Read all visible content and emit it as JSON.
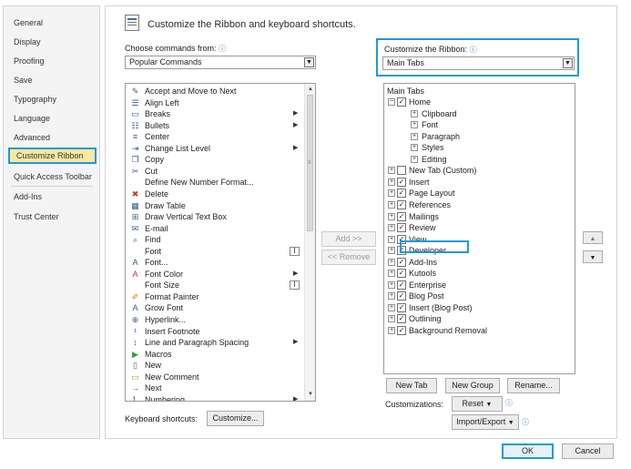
{
  "sidebar": {
    "items": [
      "General",
      "Display",
      "Proofing",
      "Save",
      "Typography",
      "Language",
      "Advanced",
      "Customize Ribbon",
      "Quick Access Toolbar",
      "Add-Ins",
      "Trust Center"
    ],
    "selected": "Customize Ribbon"
  },
  "header": {
    "title": "Customize the Ribbon and keyboard shortcuts."
  },
  "left": {
    "choose_label": "Choose commands from:",
    "choose_value": "Popular Commands",
    "commands": [
      {
        "label": "Accept and Move to Next",
        "icon": "accept-icon"
      },
      {
        "label": "Align Left",
        "icon": "align-left-icon"
      },
      {
        "label": "Breaks",
        "icon": "breaks-icon",
        "sub": true
      },
      {
        "label": "Bullets",
        "icon": "bullets-icon",
        "sub": true
      },
      {
        "label": "Center",
        "icon": "center-icon"
      },
      {
        "label": "Change List Level",
        "icon": "list-level-icon",
        "sub": true
      },
      {
        "label": "Copy",
        "icon": "copy-icon"
      },
      {
        "label": "Cut",
        "icon": "cut-icon"
      },
      {
        "label": "Define New Number Format...",
        "icon": ""
      },
      {
        "label": "Delete",
        "icon": "delete-icon"
      },
      {
        "label": "Draw Table",
        "icon": "draw-table-icon"
      },
      {
        "label": "Draw Vertical Text Box",
        "icon": "text-box-icon"
      },
      {
        "label": "E-mail",
        "icon": "email-icon"
      },
      {
        "label": "Find",
        "icon": "find-icon"
      },
      {
        "label": "Font",
        "icon": "",
        "ibeam": true
      },
      {
        "label": "Font...",
        "icon": "font-icon"
      },
      {
        "label": "Font Color",
        "icon": "font-color-icon",
        "sub": true
      },
      {
        "label": "Font Size",
        "icon": "",
        "ibeam": true
      },
      {
        "label": "Format Painter",
        "icon": "format-painter-icon"
      },
      {
        "label": "Grow Font",
        "icon": "grow-font-icon"
      },
      {
        "label": "Hyperlink...",
        "icon": "hyperlink-icon"
      },
      {
        "label": "Insert Footnote",
        "icon": "footnote-icon"
      },
      {
        "label": "Line and Paragraph Spacing",
        "icon": "line-spacing-icon",
        "sub": true
      },
      {
        "label": "Macros",
        "icon": "macros-icon"
      },
      {
        "label": "New",
        "icon": "new-icon"
      },
      {
        "label": "New Comment",
        "icon": "comment-icon"
      },
      {
        "label": "Next",
        "icon": "next-icon"
      },
      {
        "label": "Numbering",
        "icon": "numbering-icon",
        "sub": true
      }
    ],
    "keyboard_label": "Keyboard shortcuts:",
    "customize_btn": "Customize..."
  },
  "middle": {
    "add_btn": "Add >>",
    "remove_btn": "<< Remove"
  },
  "right": {
    "ribbon_label": "Customize the Ribbon:",
    "ribbon_value": "Main Tabs",
    "tree_header": "Main Tabs",
    "tree": [
      {
        "label": "Home",
        "level": 0,
        "expanded": true,
        "checked": true
      },
      {
        "label": "Clipboard",
        "level": 1
      },
      {
        "label": "Font",
        "level": 1
      },
      {
        "label": "Paragraph",
        "level": 1
      },
      {
        "label": "Styles",
        "level": 1
      },
      {
        "label": "Editing",
        "level": 1
      },
      {
        "label": "New Tab (Custom)",
        "level": 0,
        "checked": false
      },
      {
        "label": "Insert",
        "level": 0,
        "checked": true
      },
      {
        "label": "Page Layout",
        "level": 0,
        "checked": true
      },
      {
        "label": "References",
        "level": 0,
        "checked": true
      },
      {
        "label": "Mailings",
        "level": 0,
        "checked": true
      },
      {
        "label": "Review",
        "level": 0,
        "checked": true
      },
      {
        "label": "View",
        "level": 0,
        "checked": true
      },
      {
        "label": "Developer",
        "level": 0,
        "checked": true
      },
      {
        "label": "Add-Ins",
        "level": 0,
        "checked": true
      },
      {
        "label": "Kutools",
        "level": 0,
        "checked": true
      },
      {
        "label": "Enterprise",
        "level": 0,
        "checked": true
      },
      {
        "label": "Blog Post",
        "level": 0,
        "checked": true
      },
      {
        "label": "Insert (Blog Post)",
        "level": 0,
        "checked": true
      },
      {
        "label": "Outlining",
        "level": 0,
        "checked": true
      },
      {
        "label": "Background Removal",
        "level": 0,
        "checked": true
      }
    ],
    "new_tab_btn": "New Tab",
    "new_group_btn": "New Group",
    "rename_btn": "Rename...",
    "customizations_label": "Customizations:",
    "reset_btn": "Reset",
    "import_export_btn": "Import/Export"
  },
  "footer": {
    "ok": "OK",
    "cancel": "Cancel"
  },
  "colors": {
    "accent": "#1e9ad8",
    "selected_bg": "#fbe8a0"
  }
}
